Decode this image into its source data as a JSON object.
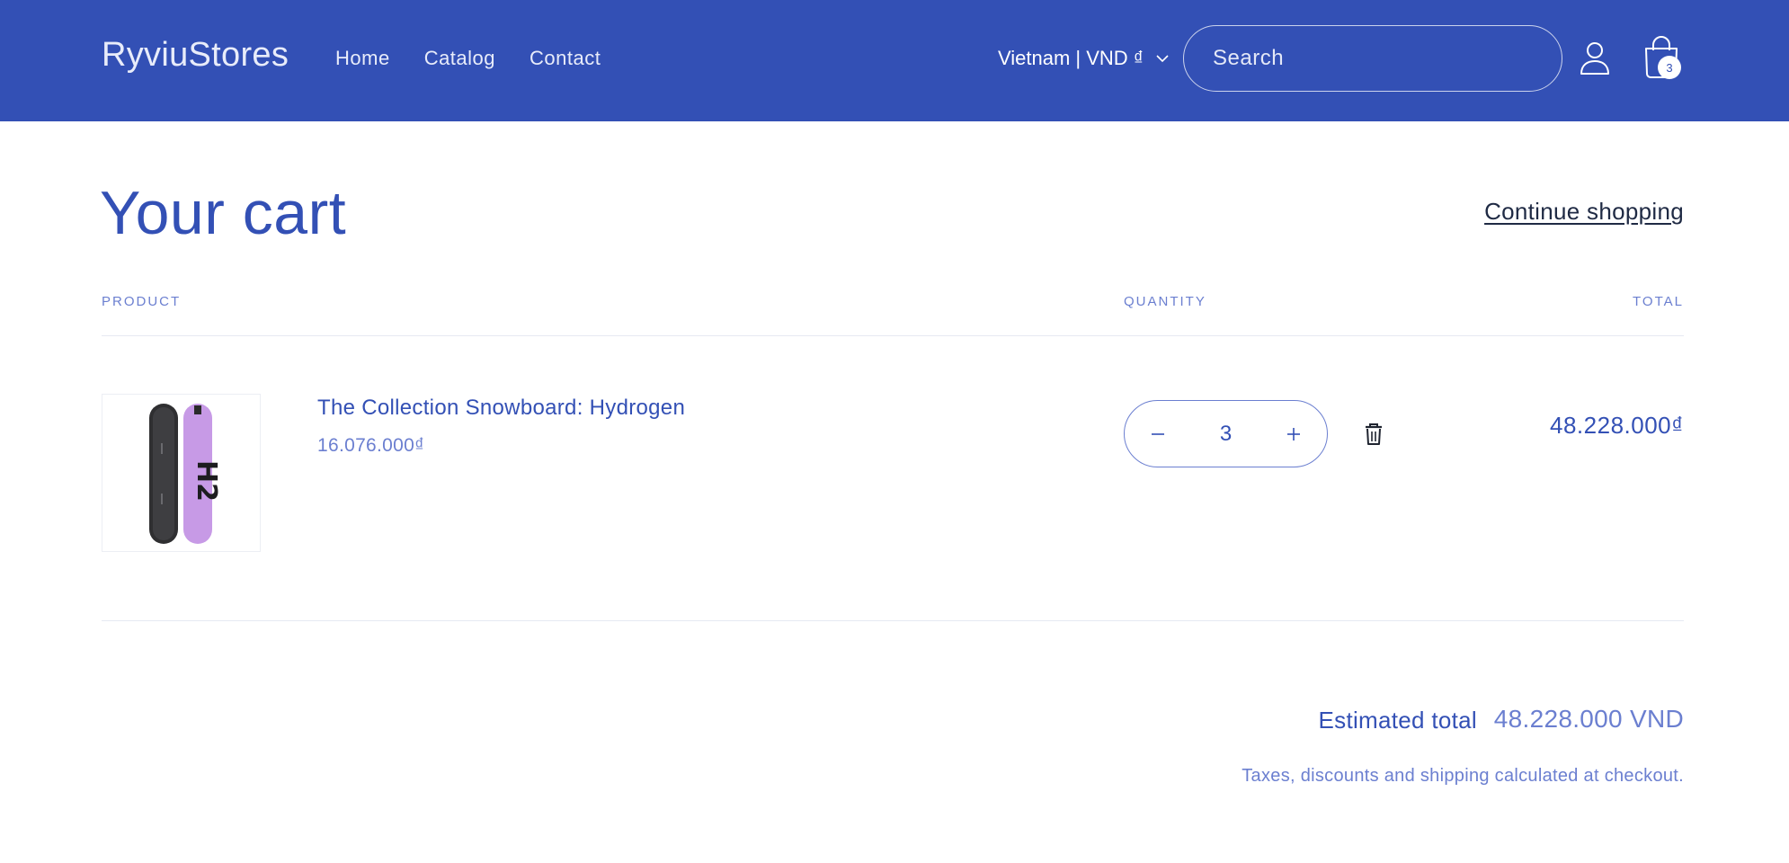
{
  "header": {
    "logo": "RyviuStores",
    "nav": [
      "Home",
      "Catalog",
      "Contact"
    ],
    "country_selector": "Vietnam | VND ₫",
    "search_placeholder": "Search",
    "cart_count": "3"
  },
  "cart": {
    "title": "Your cart",
    "continue_label": "Continue shopping",
    "columns": {
      "product": "PRODUCT",
      "quantity": "QUANTITY",
      "total": "TOTAL"
    },
    "items": [
      {
        "name": "The Collection Snowboard: Hydrogen",
        "unit_price": "16.076.000₫",
        "quantity": "3",
        "line_total": "48.228.000₫"
      }
    ],
    "estimated_total_label": "Estimated total",
    "estimated_total_value": "48.228.000 VND",
    "tax_note": "Taxes, discounts and shipping calculated at checkout."
  },
  "colors": {
    "brand": "#3350b5",
    "muted": "#6b7fd0"
  },
  "icons": [
    "chevron-down-icon",
    "account-icon",
    "cart-icon",
    "minus-icon",
    "plus-icon",
    "trash-icon"
  ]
}
